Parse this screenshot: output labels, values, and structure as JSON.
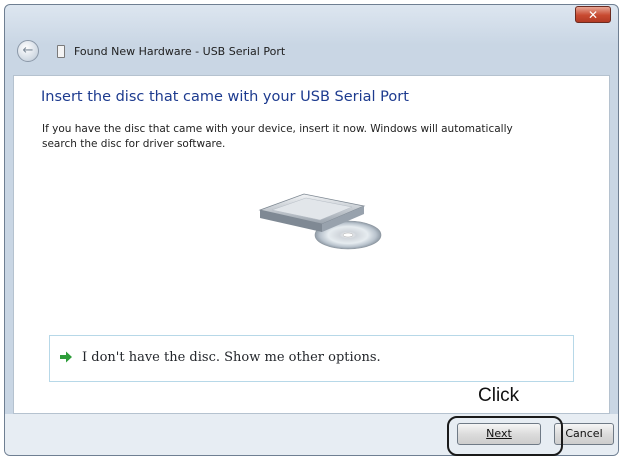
{
  "window": {
    "title": "Found New Hardware - USB Serial Port",
    "close_label": "✕"
  },
  "content": {
    "heading": "Insert the disc that came with your USB Serial Port",
    "body": "If you have the disc that came with your device, insert it now.  Windows will automatically search the disc for driver software.",
    "option_text": "I don't have the disc.  Show me other options."
  },
  "buttons": {
    "next_label": "Next",
    "cancel_label": "Cancel"
  },
  "annotation": {
    "click_label": "Click"
  },
  "icons": {
    "back": "back-arrow-icon",
    "app": "hardware-icon",
    "option": "green-arrow-icon",
    "disc": "disc-drive-illustration"
  },
  "colors": {
    "heading": "#1d3b8f",
    "close_button": "#c84a31",
    "option_arrow": "#2e9d3a",
    "option_border": "#b7d8e8"
  }
}
